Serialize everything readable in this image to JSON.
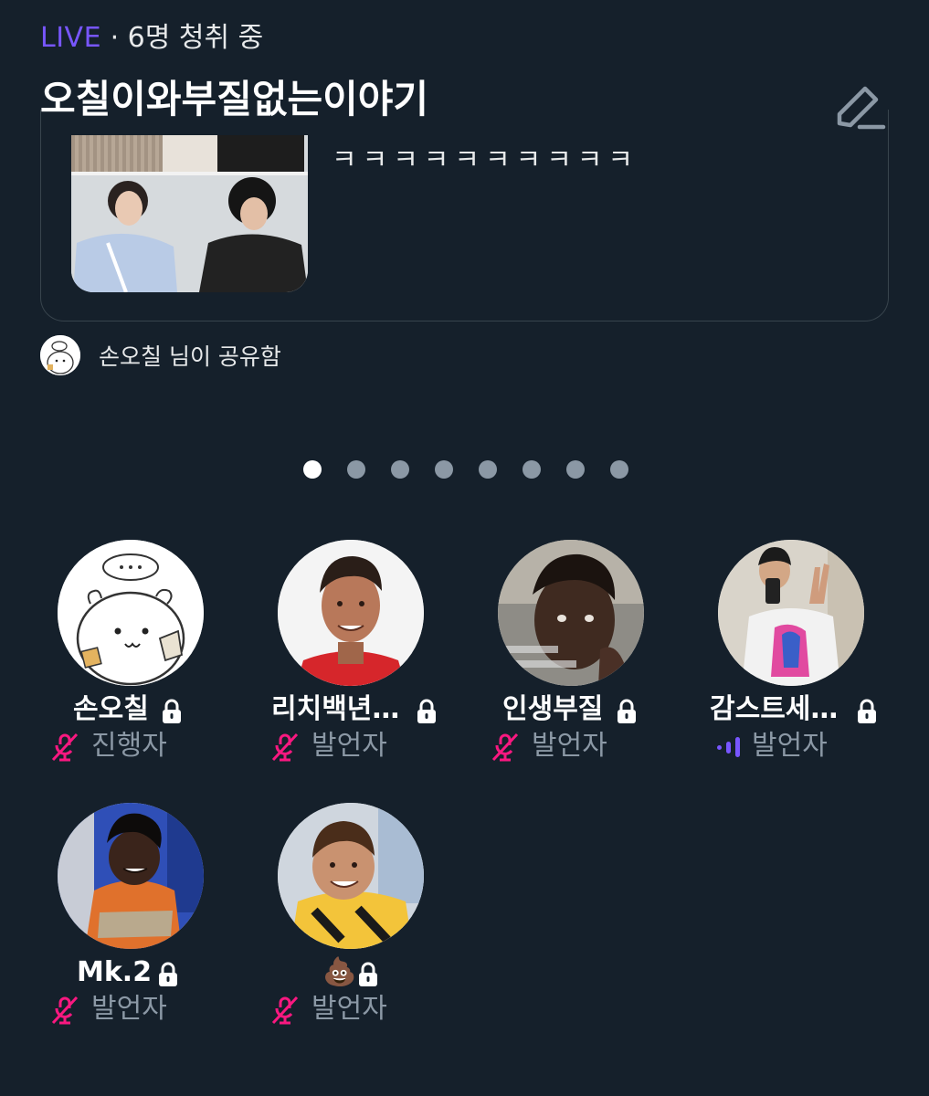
{
  "header": {
    "live_label": "LIVE",
    "listeners": "· 6명 청취 중",
    "title": "오칠이와부질없는이야기"
  },
  "shared_card": {
    "text": "ㅋㅋㅋㅋㅋㅋㅋㅋㅋㅋ",
    "shared_by": "손오칠 님이 공유함"
  },
  "pager": {
    "count": 8,
    "active_index": 0
  },
  "participants": [
    {
      "name": "손오칠",
      "role": "진행자",
      "locked": true,
      "mic": "muted"
    },
    {
      "name": "리치백년…",
      "role": "발언자",
      "locked": true,
      "mic": "muted"
    },
    {
      "name": "인생부질",
      "role": "발언자",
      "locked": true,
      "mic": "muted"
    },
    {
      "name": "감스트세…",
      "role": "발언자",
      "locked": true,
      "mic": "speaking"
    },
    {
      "name": "Mk.2",
      "role": "발언자",
      "locked": true,
      "mic": "muted"
    },
    {
      "name": "💩",
      "role": "발언자",
      "locked": true,
      "mic": "muted"
    }
  ],
  "colors": {
    "background": "#15202b",
    "live_accent": "#7856ff",
    "muted_icon": "#f91880",
    "secondary_text": "#8b98a5"
  }
}
